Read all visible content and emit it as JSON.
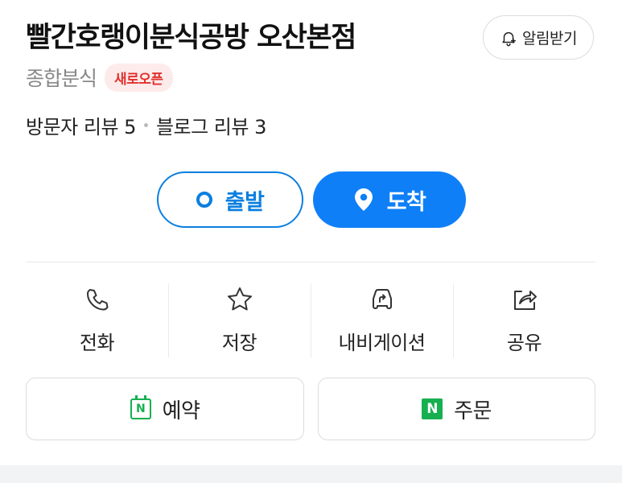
{
  "place": {
    "name": "빨간호랭이분식공방 오산본점",
    "category": "종합분식",
    "badge": "새로오픈"
  },
  "alarm": {
    "label": "알림받기",
    "icon": "bell-plus-icon"
  },
  "reviews": {
    "visitor": "방문자 리뷰 5",
    "blog": "블로그 리뷰 3"
  },
  "route": {
    "start_label": "출발",
    "end_label": "도착",
    "accent": "#0e7ff7"
  },
  "actions": [
    {
      "label": "전화",
      "icon": "phone-icon"
    },
    {
      "label": "저장",
      "icon": "star-icon"
    },
    {
      "label": "내비게이션",
      "icon": "car-navigation-icon"
    },
    {
      "label": "공유",
      "icon": "share-icon"
    }
  ],
  "booking": {
    "reserve_label": "예약",
    "order_label": "주문",
    "brand_color": "#16b050",
    "naver_letter": "N"
  }
}
